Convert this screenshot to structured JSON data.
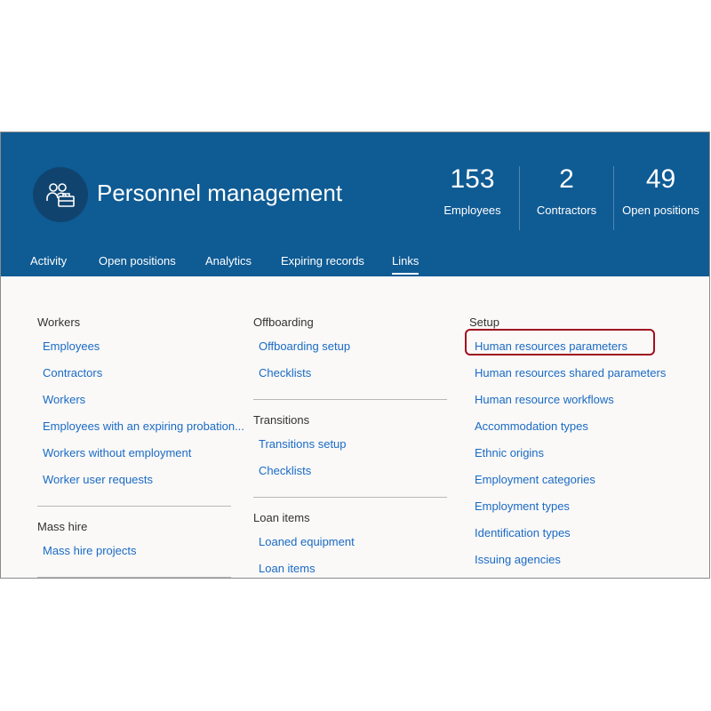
{
  "workspace": {
    "title": "Personnel management",
    "icon": "people-briefcase-icon"
  },
  "kpis": [
    {
      "value": "153",
      "label": "Employees"
    },
    {
      "value": "2",
      "label": "Contractors"
    },
    {
      "value": "49",
      "label": "Open positions"
    }
  ],
  "tabs": [
    {
      "label": "Activity"
    },
    {
      "label": "Open positions"
    },
    {
      "label": "Analytics"
    },
    {
      "label": "Expiring records"
    },
    {
      "label": "Links"
    }
  ],
  "active_tab": "Links",
  "columns": {
    "left": {
      "workers": {
        "title": "Workers",
        "links": [
          "Employees",
          "Contractors",
          "Workers",
          "Employees with an expiring probation...",
          "Workers without employment",
          "Worker user requests"
        ]
      },
      "mass_hire": {
        "title": "Mass hire",
        "links": [
          "Mass hire projects"
        ]
      }
    },
    "middle": {
      "offboarding": {
        "title": "Offboarding",
        "links": [
          "Offboarding setup",
          "Checklists"
        ]
      },
      "transitions": {
        "title": "Transitions",
        "links": [
          "Transitions setup",
          "Checklists"
        ]
      },
      "loan_items": {
        "title": "Loan items",
        "links": [
          "Loaned equipment",
          "Loan items"
        ]
      }
    },
    "right": {
      "setup": {
        "title": "Setup",
        "links": [
          "Human resources parameters",
          "Human resources shared parameters",
          "Human resource workflows",
          "Accommodation types",
          "Ethnic origins",
          "Employment categories",
          "Employment types",
          "Identification types",
          "Issuing agencies"
        ]
      }
    }
  },
  "highlighted_link": "Human resources parameters",
  "colors": {
    "header_bg": "#0f5b94",
    "icon_circle": "#10446f",
    "link": "#1a6ac4",
    "highlight_border": "#a0101f"
  }
}
